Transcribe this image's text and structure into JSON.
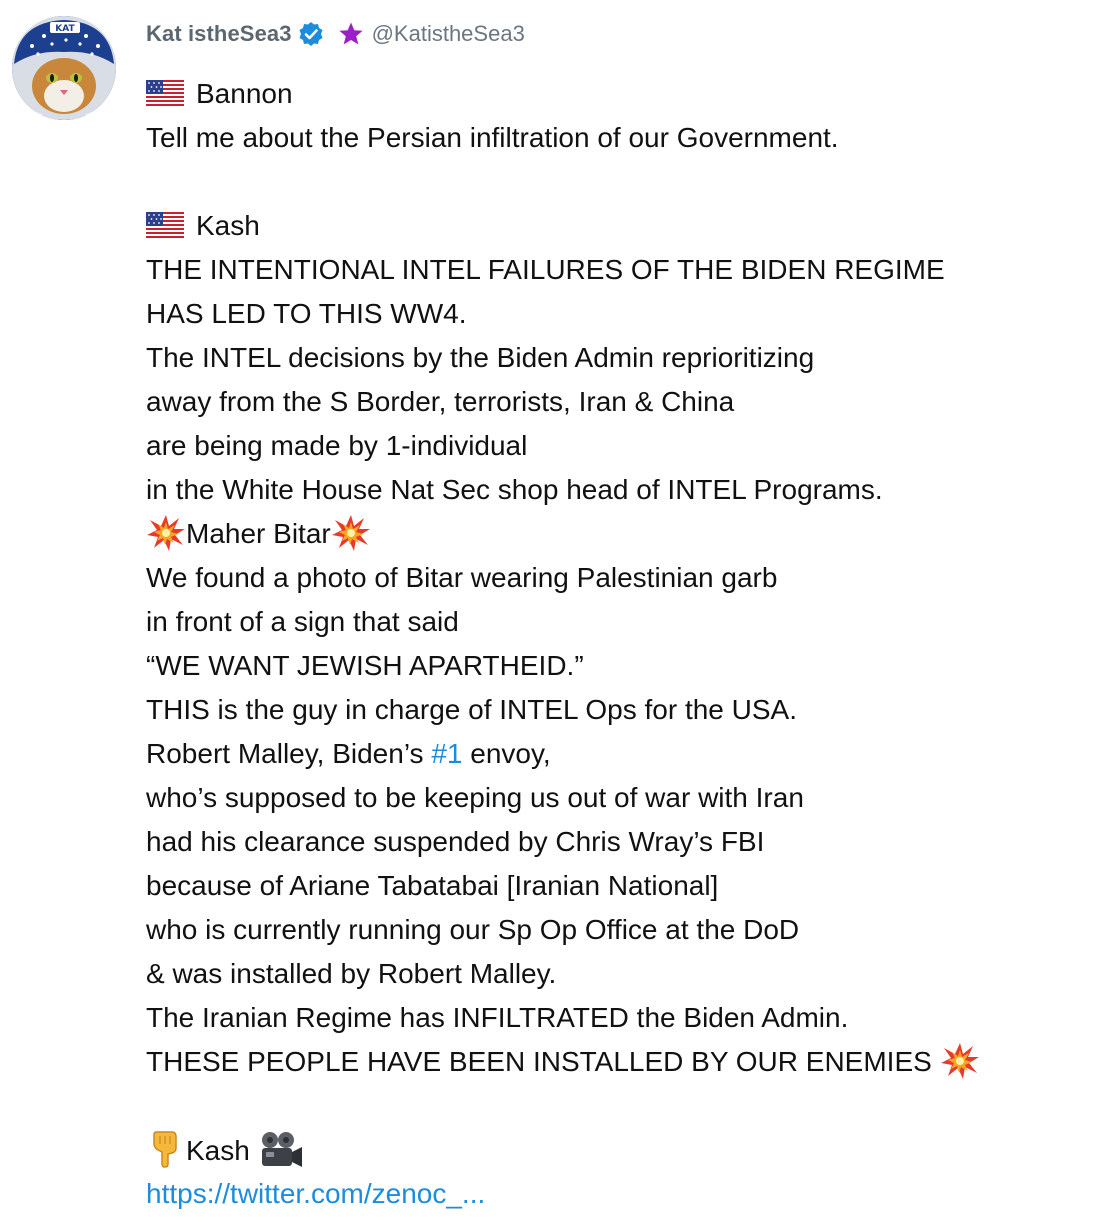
{
  "author": {
    "display_name": "Kat istheSea3",
    "handle": "@KatistheSea3",
    "avatar_text": "KAT",
    "verified_icon": "verified-badge-icon",
    "badge_icon": "purple-star-icon",
    "badge_color": "#9b1fc9",
    "verified_color": "#1d8cdc"
  },
  "post": {
    "speaker1_name": "Bannon",
    "speaker1_line": "Tell me about the Persian infiltration of our Government.",
    "speaker2_name": "Kash",
    "kash_lines": [
      "THE INTENTIONAL INTEL FAILURES OF THE BIDEN REGIME",
      "HAS LED TO THIS WW4.",
      "The INTEL decisions by the Biden Admin reprioritizing",
      "away from the S Border, terrorists, Iran & China",
      "are being made by 1-individual",
      "in the White House Nat Sec shop head of INTEL Programs."
    ],
    "highlight_name": "Maher Bitar",
    "bitar_lines": [
      "We found a photo of Bitar wearing Palestinian garb",
      "in front of a sign that said",
      "“WE WANT JEWISH APARTHEID.”",
      "THIS is the guy in charge of INTEL Ops for the USA."
    ],
    "malley_prefix": "Robert Malley, Biden’s ",
    "hashtag": "#1",
    "malley_suffix": " envoy,",
    "malley_lines": [
      "who’s supposed to be keeping us out of war with Iran",
      "had his clearance suspended by Chris Wray’s FBI",
      "because of Ariane Tabatabai [Iranian National]",
      "who is currently running our Sp Op Office at the DoD",
      "& was installed by Robert Malley.",
      "The Iranian Regime has INFILTRATED the Biden Admin."
    ],
    "final_line": "THESE PEOPLE HAVE BEEN INSTALLED BY OUR ENEMIES",
    "video_label": "Kash",
    "link_text": "https://twitter.com/zenoc_...",
    "link_color": "#1d8cdc",
    "icons": [
      "us-flag-icon",
      "collision-icon",
      "pointing-down-icon",
      "movie-camera-icon"
    ]
  }
}
